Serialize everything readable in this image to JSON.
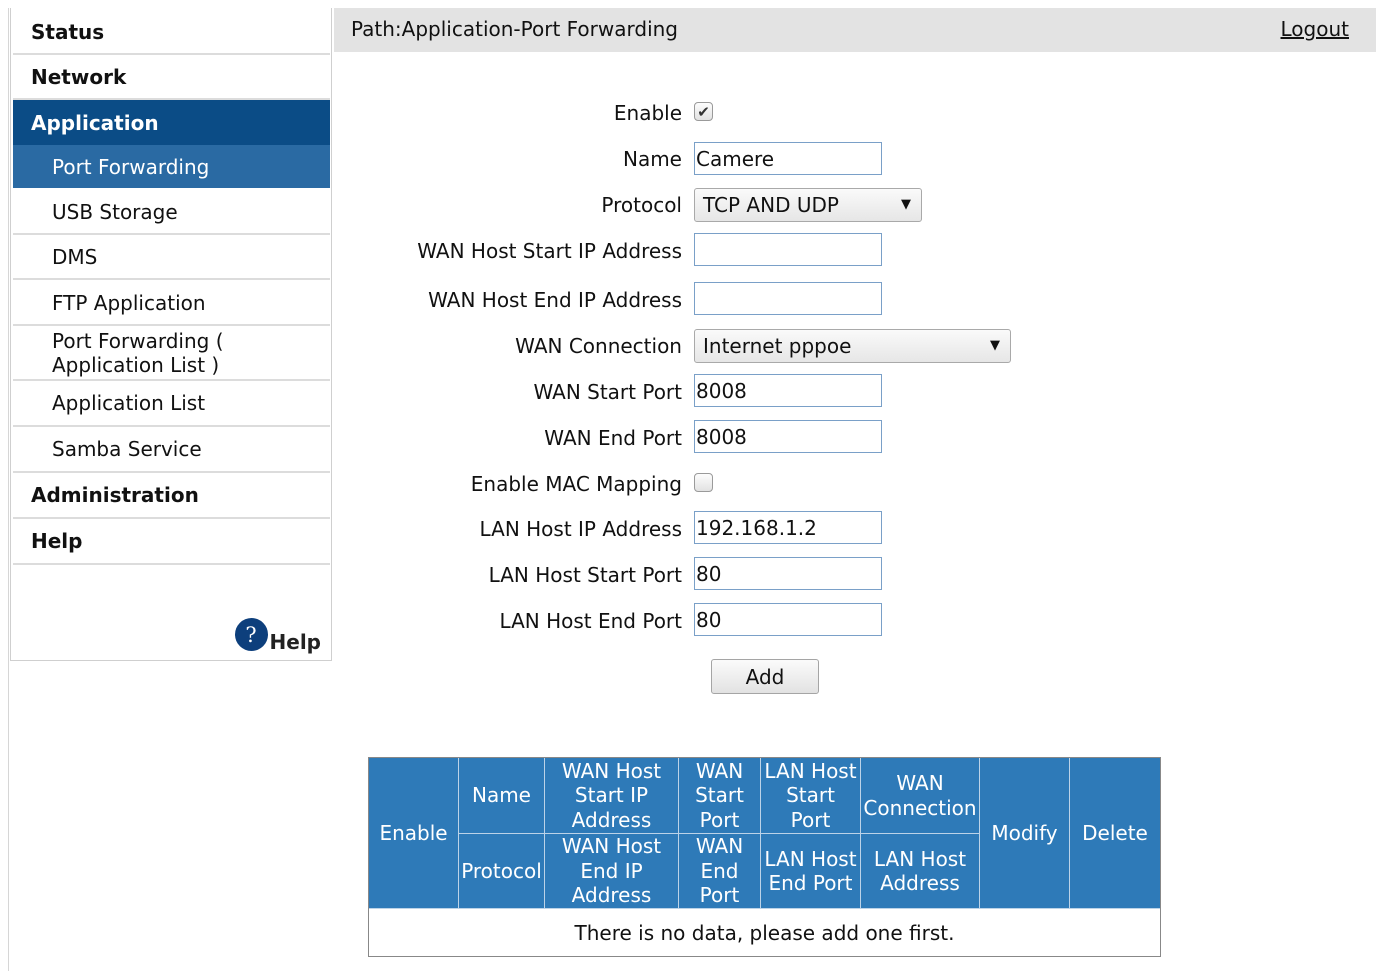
{
  "header": {
    "path": "Path:Application-Port Forwarding",
    "logout": "Logout"
  },
  "sidebar": {
    "items": [
      {
        "label": "Status",
        "level": "top"
      },
      {
        "label": "Network",
        "level": "top"
      },
      {
        "label": "Application",
        "level": "top",
        "active": true
      },
      {
        "label": "Port Forwarding",
        "level": "sub",
        "active": true
      },
      {
        "label": "USB Storage",
        "level": "sub"
      },
      {
        "label": "DMS",
        "level": "sub"
      },
      {
        "label": "FTP Application",
        "level": "sub"
      },
      {
        "label": "Port Forwarding (\nApplication List )",
        "level": "sub"
      },
      {
        "label": "Application List",
        "level": "sub"
      },
      {
        "label": "Samba Service",
        "level": "sub"
      },
      {
        "label": "Administration",
        "level": "top"
      },
      {
        "label": "Help",
        "level": "top"
      }
    ],
    "help_icon_glyph": "?",
    "help_label": "Help"
  },
  "form": {
    "enable": {
      "label": "Enable",
      "checked": true
    },
    "name": {
      "label": "Name",
      "value": "Camere"
    },
    "protocol": {
      "label": "Protocol",
      "value": "TCP AND UDP",
      "caret": "▼"
    },
    "wan_host_start_ip": {
      "label": "WAN Host Start IP Address",
      "value": ""
    },
    "wan_host_end_ip": {
      "label": "WAN Host End IP Address",
      "value": ""
    },
    "wan_connection": {
      "label": "WAN Connection",
      "value": "Internet pppoe",
      "caret": "▼"
    },
    "wan_start_port": {
      "label": "WAN Start Port",
      "value": "8008"
    },
    "wan_end_port": {
      "label": "WAN End Port",
      "value": "8008"
    },
    "mac_mapping": {
      "label": "Enable MAC Mapping",
      "checked": false
    },
    "lan_host_ip": {
      "label": "LAN Host IP Address",
      "value": "192.168.1.2"
    },
    "lan_host_start_port": {
      "label": "LAN Host Start Port",
      "value": "80"
    },
    "lan_host_end_port": {
      "label": "LAN Host End Port",
      "value": "80"
    },
    "add_label": "Add",
    "check_glyph": "✔"
  },
  "table": {
    "enable": "Enable",
    "name": "Name",
    "protocol": "Protocol",
    "wan_host_start_ip": "WAN Host\nStart IP\nAddress",
    "wan_host_end_ip": "WAN Host\nEnd IP\nAddress",
    "wan_start_port": "WAN\nStart\nPort",
    "wan_end_port": "WAN\nEnd\nPort",
    "lan_host_start_port": "LAN Host\nStart\nPort",
    "lan_host_end_port": "LAN Host\nEnd Port",
    "wan_connection": "WAN\nConnection",
    "lan_host_address": "LAN Host\nAddress",
    "modify": "Modify",
    "delete": "Delete",
    "empty_message": "There is no data, please add one first."
  },
  "colors": {
    "active_top": "#0b4c86",
    "active_sub": "#2a6aa3",
    "table_header": "#2e7ab8",
    "path_bar": "#e3e3e3"
  }
}
